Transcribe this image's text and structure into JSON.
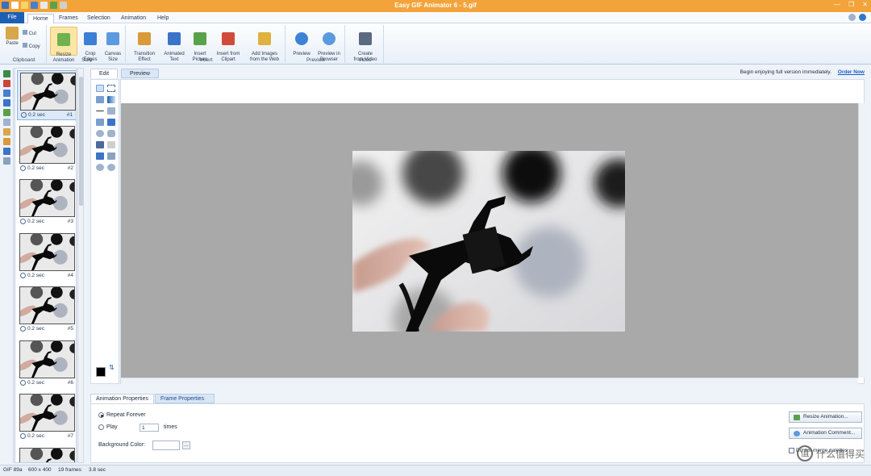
{
  "window": {
    "title": "Easy GIF Animator 6 - 5.gif"
  },
  "tabs": [
    "File",
    "Home",
    "Frames",
    "Selection",
    "Animation",
    "Help"
  ],
  "ribbon": {
    "groups": [
      {
        "label": "Clipboard",
        "buttons": [
          "Paste",
          "Cut",
          "Copy"
        ]
      },
      {
        "label": "Size",
        "buttons": [
          "Resize\nAnimation",
          "Crop\nEdges",
          "Canvas\nSize"
        ]
      },
      {
        "label": "Insert",
        "buttons": [
          "Transition\nEffect",
          "Animated\nText",
          "Insert\nPicture",
          "Insert from\nClipart",
          "Add Images\nfrom the Web"
        ]
      },
      {
        "label": "Preview",
        "buttons": [
          "Preview",
          "Preview in\nBrowser"
        ]
      },
      {
        "label": "Video",
        "buttons": [
          "Create\nfrom Video"
        ]
      }
    ]
  },
  "frames": [
    {
      "duration": "0.2 sec",
      "number": "#1"
    },
    {
      "duration": "0.2 sec",
      "number": "#2"
    },
    {
      "duration": "0.2 sec",
      "number": "#3"
    },
    {
      "duration": "0.2 sec",
      "number": "#4"
    },
    {
      "duration": "0.2 sec",
      "number": "#5"
    },
    {
      "duration": "0.2 sec",
      "number": "#6"
    },
    {
      "duration": "0.2 sec",
      "number": "#7"
    }
  ],
  "editor": {
    "tabs": [
      "Edit",
      "Preview"
    ],
    "promo_text": "Begin enjoying full version immediately.",
    "promo_link": "Order Now"
  },
  "properties": {
    "tabs": [
      "Animation Properties",
      "Frame Properties"
    ],
    "repeat_forever": "Repeat Forever",
    "play": "Play",
    "play_count": "1",
    "times": "times",
    "background_color": "Background Color:",
    "ellipsis": "...",
    "resize_button": "Resize Animation...",
    "comment_button": "Animation Comment...",
    "merge_palettes": "Do not merge palettes"
  },
  "status": {
    "format": "GIF 89a",
    "dimensions": "600 x 400",
    "frame_count": "19 frames",
    "total_time": "3.8 sec"
  },
  "watermark": {
    "seal": "值",
    "text": "什么值得买"
  },
  "colors": {
    "accent": "#1c5fb3",
    "titlebar": "#f2a33a",
    "canvas": "#a9a9a9"
  }
}
